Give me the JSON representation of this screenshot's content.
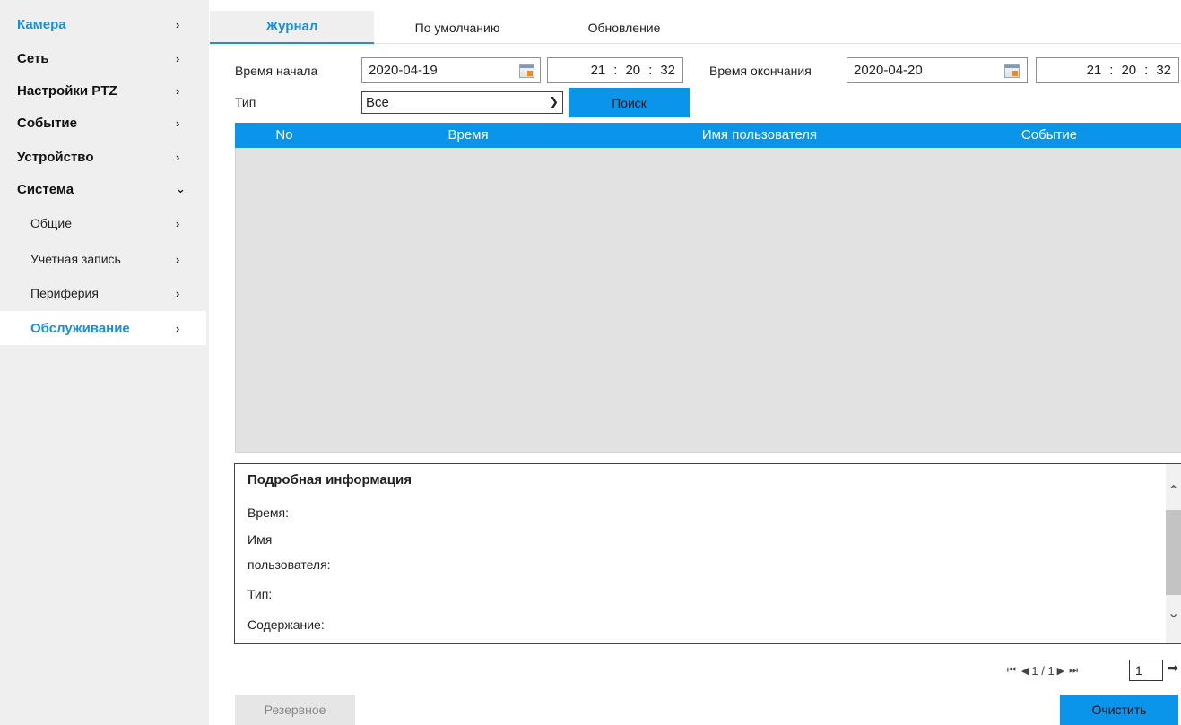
{
  "sidebar": {
    "items": [
      {
        "label": "Камера",
        "chevron": "›"
      },
      {
        "label": "Сеть",
        "chevron": "›"
      },
      {
        "label": "Настройки PTZ",
        "chevron": "›"
      },
      {
        "label": "Событие",
        "chevron": "›"
      },
      {
        "label": "Устройство",
        "chevron": "›"
      },
      {
        "label": "Система",
        "chevron": "⌄"
      }
    ],
    "subitems": [
      {
        "label": "Общие",
        "chevron": "›"
      },
      {
        "label": "Учетная запись",
        "chevron": "›"
      },
      {
        "label": "Периферия",
        "chevron": "›"
      },
      {
        "label": "Обслуживание",
        "chevron": "›"
      }
    ]
  },
  "tabs": [
    "Журнал",
    "По умолчанию",
    "Обновление"
  ],
  "form": {
    "start_label": "Время начала",
    "start_date": "2020-04-19",
    "start_time": {
      "h": "21",
      "m": "20",
      "s": "32"
    },
    "end_label": "Время окончания",
    "end_date": "2020-04-20",
    "end_time": {
      "h": "21",
      "m": "20",
      "s": "32"
    },
    "type_label": "Тип",
    "type_value": "Все",
    "search_label": "Поиск",
    "time_sep": ":"
  },
  "table": {
    "columns": [
      "No",
      "Время",
      "Имя пользователя",
      "Событие"
    ]
  },
  "details": {
    "title": "Подробная информация",
    "time_label": "Время:",
    "user_label_1": "Имя",
    "user_label_2": "пользователя:",
    "type_label": "Тип:",
    "content_label": "Содержание:"
  },
  "pager": {
    "first": "⏮",
    "prev": "◀",
    "page_info": "1 / 1",
    "next": "▶",
    "last": "⏭",
    "page_input": "1",
    "go": "➡"
  },
  "buttons": {
    "backup": "Резервное",
    "clear": "Очистить"
  },
  "colors": {
    "accent": "#0a95ea",
    "sidebar_bg": "#efefef",
    "table_body": "#e2e2e2"
  }
}
